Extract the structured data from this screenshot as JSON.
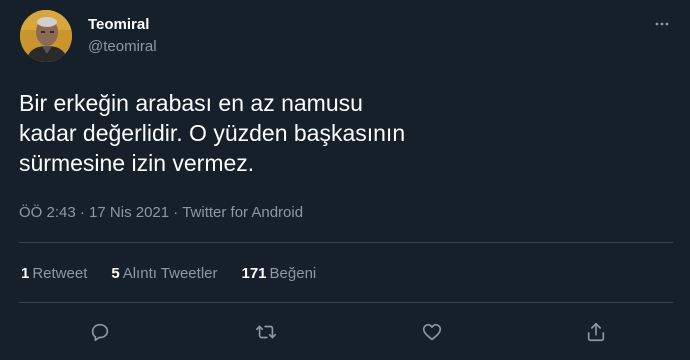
{
  "user": {
    "display_name": "Teomiral",
    "handle": "@teomiral"
  },
  "tweet": {
    "lines": [
      "Bir erkeğin arabası en az namusu",
      "kadar değerlidir. O yüzden başkasının",
      "sürmesine izin vermez."
    ],
    "time": "ÖÖ 2:43",
    "date": "17 Nis 2021",
    "separator": "·",
    "source": "Twitter for Android"
  },
  "stats": [
    {
      "count": "1",
      "label": "Retweet"
    },
    {
      "count": "5",
      "label": "Alıntı Tweetler"
    },
    {
      "count": "171",
      "label": "Beğeni"
    }
  ],
  "icons": {
    "more": "more-icon",
    "reply": "reply-icon",
    "retweet": "retweet-icon",
    "like": "like-icon",
    "share": "share-icon"
  },
  "colors": {
    "background": "#15202b",
    "text": "#ffffff",
    "secondary": "#8b98a5",
    "divider": "#38444d"
  }
}
